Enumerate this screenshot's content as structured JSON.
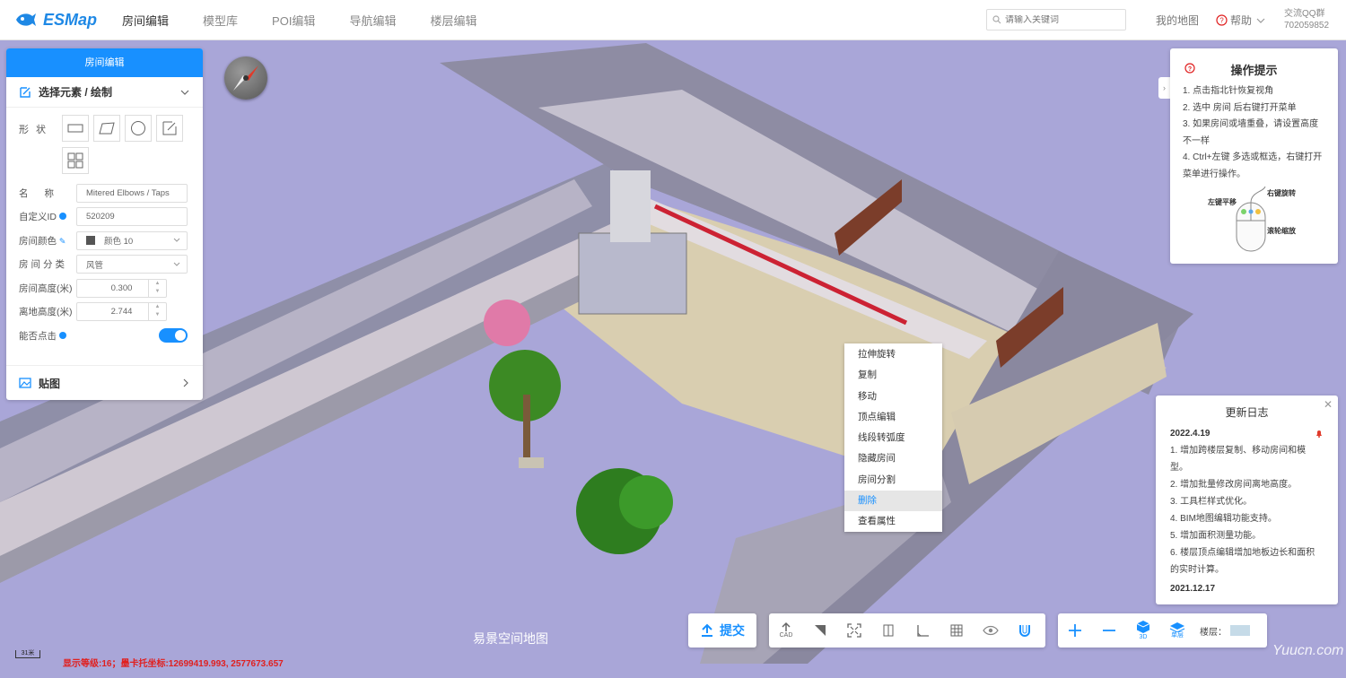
{
  "header": {
    "logo_text": "ESMap",
    "nav": [
      "房间编辑",
      "模型库",
      "POI编辑",
      "导航编辑",
      "楼层编辑"
    ],
    "search_placeholder": "请输入关键词",
    "my_map": "我的地图",
    "help": "帮助",
    "qq_label": "交流QQ群",
    "qq_number": "702059852"
  },
  "left_panel": {
    "title": "房间编辑",
    "section": "选择元素 / 绘制",
    "shape_label": "形状",
    "name_label": "名称",
    "name_value": "Mitered Elbows / Taps",
    "id_label": "自定义ID",
    "id_value": "520209",
    "color_label": "房间颜色",
    "color_value": "颜色 10",
    "category_label": "房间分类",
    "category_value": "风管",
    "height_label": "房间高度(米)",
    "height_value": "0.300",
    "ground_label": "离地高度(米)",
    "ground_value": "2.744",
    "clickable_label": "能否点击",
    "texture": "贴图"
  },
  "tips": {
    "title": "操作提示",
    "lines": [
      "1. 点击指北针恢复视角",
      "2. 选中 房间 后右键打开菜单",
      "3. 如果房间或墙重叠，请设置高度不一样",
      "4. Ctrl+左键 多选或框选，右键打开菜单进行操作。"
    ],
    "mouse_left": "左键平移",
    "mouse_right": "右键旋转",
    "mouse_wheel": "滚轮缩放"
  },
  "changelog": {
    "title": "更新日志",
    "date1": "2022.4.19",
    "items": [
      "1. 增加跨楼层复制、移动房间和模型。",
      "2. 增加批量修改房间离地高度。",
      "3. 工具栏样式优化。",
      "4. BIM地图编辑功能支持。",
      "5. 增加面积测量功能。",
      "6. 楼层顶点编辑增加地板边长和面积的实时计算。"
    ],
    "date2": "2021.12.17"
  },
  "context_menu": [
    "拉伸旋转",
    "复制",
    "移动",
    "顶点编辑",
    "线段转弧度",
    "隐藏房间",
    "房间分割",
    "删除",
    "查看属性"
  ],
  "toolbar": {
    "submit": "提交",
    "cad": "CAD",
    "view3d": "3D",
    "single": "单层",
    "floor_label": "楼层："
  },
  "scene": {
    "title": "易景空间地图",
    "status": "显示等级:16；墨卡托坐标:12699419.993, 2577673.657",
    "scale": "31米",
    "watermark": "Yuucn.com"
  }
}
